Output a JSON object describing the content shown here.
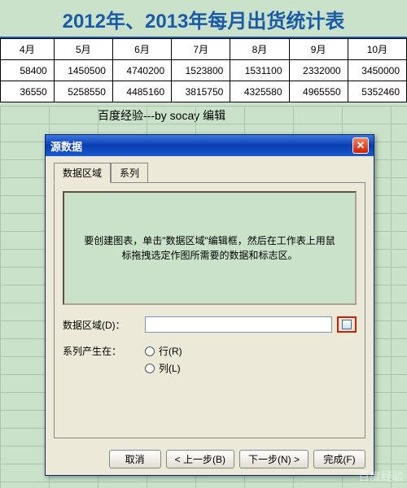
{
  "sheet": {
    "title": "2012年、2013年每月出货统计表",
    "months": [
      "4月",
      "5月",
      "6月",
      "7月",
      "8月",
      "9月",
      "10月"
    ],
    "row1": [
      "58400",
      "1450500",
      "4740200",
      "1523800",
      "1531100",
      "2332000",
      "3450000"
    ],
    "row2": [
      "36550",
      "5258550",
      "4485160",
      "3815750",
      "4325580",
      "4965550",
      "5352460"
    ],
    "footer": "百度经验---by socay 编辑"
  },
  "dialog": {
    "title": "源数据",
    "tabs": {
      "data_range": "数据区域",
      "series": "系列"
    },
    "preview_msg": "要创建图表，单击\"数据区域\"编辑框，然后在工作表上用鼠标拖拽选定作图所需要的数据和标志区。",
    "labels": {
      "data_range": "数据区域(D)：",
      "series_in": "系列产生在：",
      "row": "行(R)",
      "col": "列(L)"
    },
    "input_value": "",
    "buttons": {
      "cancel": "取消",
      "back": "< 上一步(B)",
      "next": "下一步(N) >",
      "finish": "完成(F)"
    }
  },
  "watermark": "百度经验"
}
